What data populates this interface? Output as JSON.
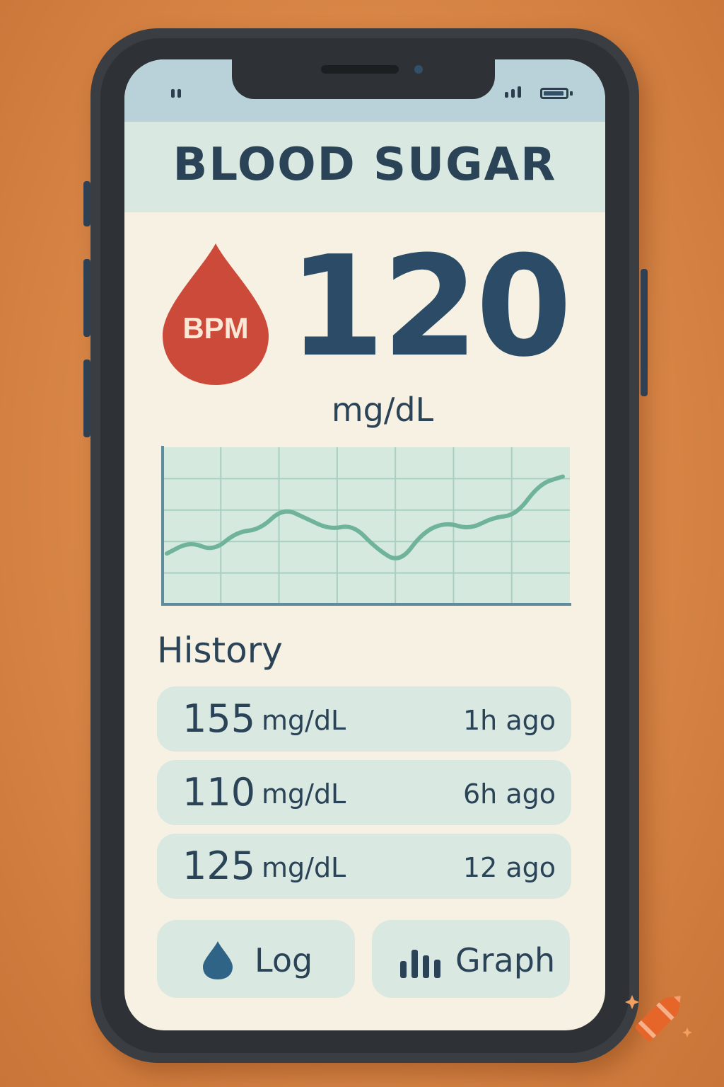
{
  "app": {
    "title": "BLOOD SUGAR"
  },
  "current": {
    "badge_label": "BPM",
    "value": "120",
    "unit": "mg/dL"
  },
  "trend_chart": {
    "type": "line",
    "grid": true,
    "points": [
      34,
      44,
      36,
      52,
      54,
      72,
      63,
      54,
      58,
      38,
      26,
      52,
      60,
      54,
      64,
      66,
      92,
      98
    ]
  },
  "history": {
    "heading": "History",
    "items": [
      {
        "value": "155",
        "unit": "mg/dL",
        "time": "1h ago"
      },
      {
        "value": "110",
        "unit": "mg/dL",
        "time": "6h ago"
      },
      {
        "value": "125",
        "unit": "mg/dL",
        "time": "12 ago"
      }
    ]
  },
  "actions": {
    "log_label": "Log",
    "graph_label": "Graph"
  },
  "colors": {
    "primary_text": "#2b4356",
    "accent_red": "#cc4a3a",
    "chart_line": "#6fb49a",
    "card_bg": "#d9e8e0",
    "screen_bg": "#f6f1e2"
  },
  "icons": {
    "drop": "blood-drop-icon",
    "log": "water-drop-icon",
    "graph": "bar-chart-icon"
  }
}
